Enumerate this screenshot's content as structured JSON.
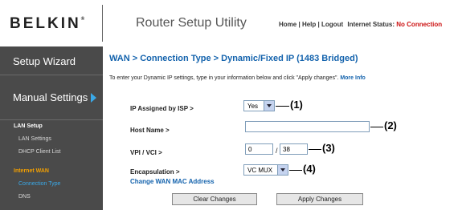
{
  "header": {
    "logo": "BELKIN",
    "logo_mark": "®",
    "app_title": "Router Setup Utility",
    "links": [
      "Home",
      "Help",
      "Logout"
    ],
    "separator": "|",
    "internet_status_label": "Internet Status:",
    "internet_status_value": "No Connection"
  },
  "sidebar": {
    "setup_wizard": "Setup Wizard",
    "manual_settings": "Manual Settings",
    "sections": [
      {
        "title": "LAN Setup",
        "items": [
          "LAN Settings",
          "DHCP Client List"
        ]
      },
      {
        "title": "Internet WAN",
        "items": [
          "Connection Type",
          "DNS"
        ]
      }
    ]
  },
  "main": {
    "title": "WAN > Connection Type > Dynamic/Fixed IP (1483 Bridged)",
    "intro": "To enter your Dynamic IP settings, type in your information below and click \"Apply changes\".",
    "more_info": "More Info",
    "fields": {
      "ip_assigned_label": "IP Assigned by ISP >",
      "ip_assigned_value": "Yes",
      "host_name_label": "Host Name >",
      "host_name_value": "",
      "vpi_vci_label": "VPI / VCI >",
      "vpi_value": "0",
      "vci_separator": "/",
      "vci_value": "38",
      "encapsulation_label": "Encapsulation >",
      "encapsulation_value": "VC MUX"
    },
    "change_mac_link": "Change WAN MAC Address",
    "callouts": [
      "(1)",
      "(2)",
      "(3)",
      "(4)"
    ],
    "buttons": {
      "clear": "Clear Changes",
      "apply": "Apply Changes"
    }
  },
  "colors": {
    "sidebar_bg": "#4a4a4a",
    "title_blue": "#1463ad",
    "active_blue": "#3aa9e8",
    "section_orange": "#f4a000",
    "status_red": "#cc1111"
  }
}
